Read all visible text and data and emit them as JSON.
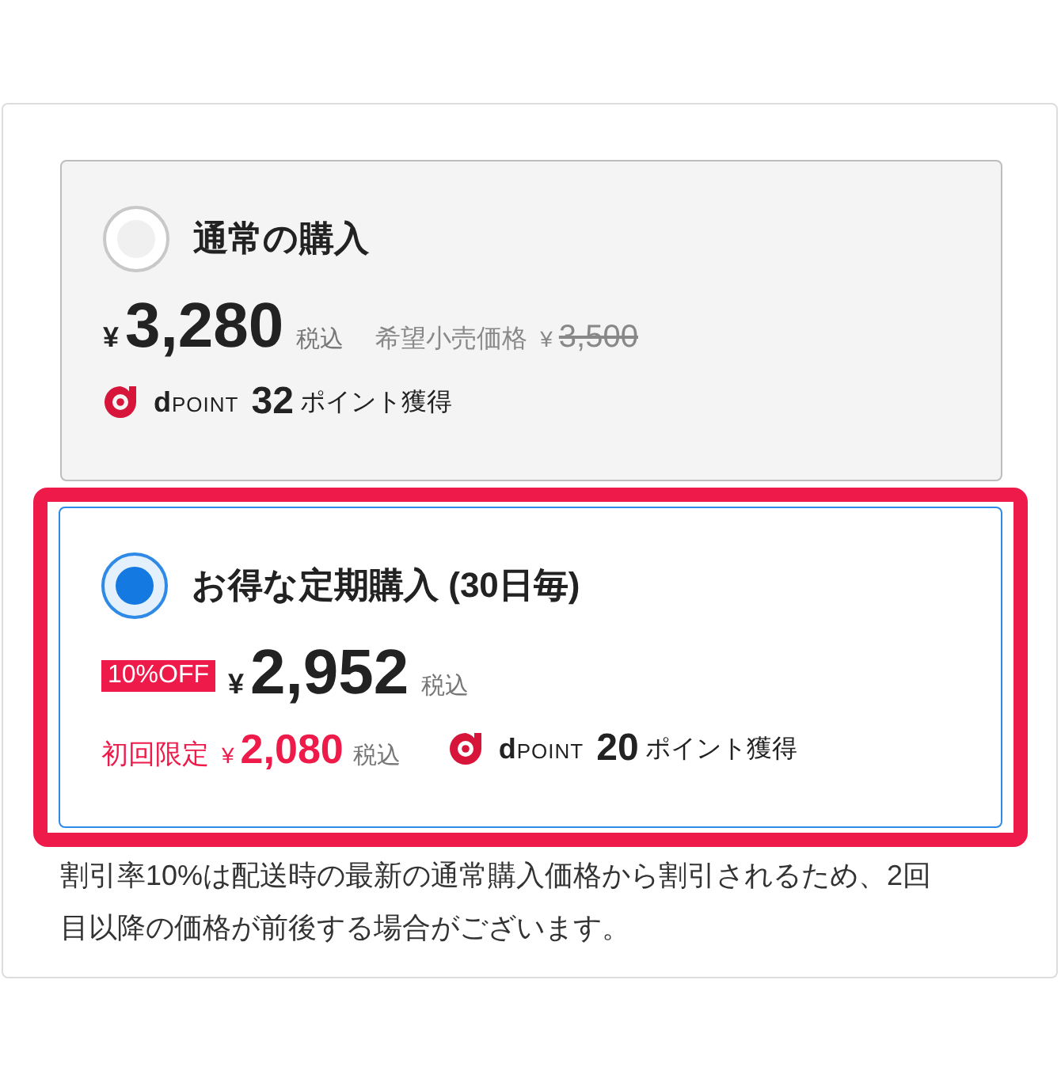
{
  "options": [
    {
      "selected": false,
      "title": "通常の購入",
      "currency": "¥",
      "price": "3,280",
      "tax": "税込",
      "msrp_label": "希望小売価格",
      "msrp_currency": "¥",
      "msrp_price": "3,500",
      "point_brand": "**d**POINT",
      "points": "32",
      "points_suffix": "ポイント獲得"
    },
    {
      "selected": true,
      "title": "お得な定期購入 (30日毎)",
      "discount_badge": "10%OFF",
      "currency": "¥",
      "price": "2,952",
      "tax": "税込",
      "first_time_label": "初回限定",
      "first_time_currency": "¥",
      "first_time_price": "2,080",
      "first_time_tax": "税込",
      "point_brand": "**d**POINT",
      "points": "20",
      "points_suffix": "ポイント獲得"
    }
  ],
  "note": "割引率10%は配送時の最新の通常購入価格から割引されるため、2回目以降の価格が前後する場合がございます。"
}
